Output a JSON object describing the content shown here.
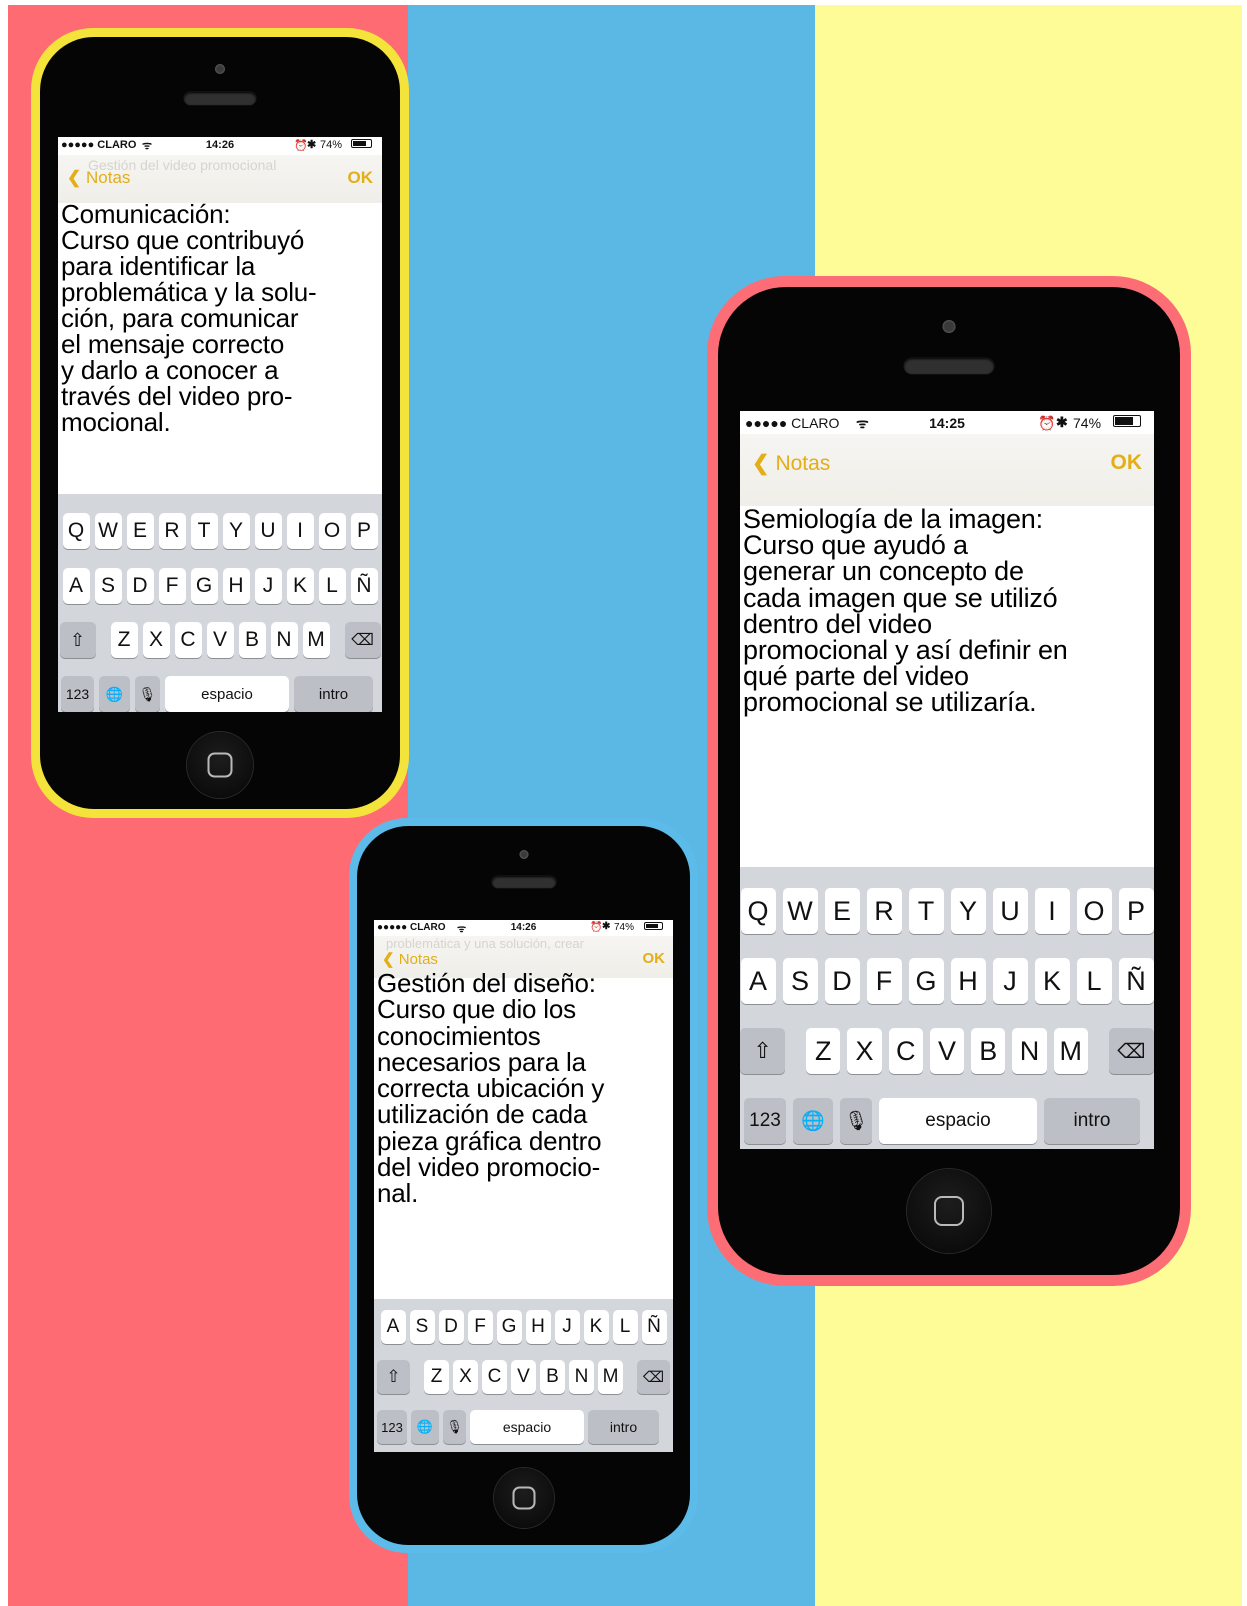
{
  "colors": {
    "stripe_red": "#fe6b72",
    "stripe_blue": "#5bb8e5",
    "stripe_yellow": "#fefc96",
    "phone_yellow": "#f3e33a",
    "phone_blue": "#5cbbe9",
    "phone_pink": "#fc6d75",
    "accent": "#e3ae18"
  },
  "icons": [
    "signal-dots-icon",
    "wifi-icon",
    "alarm-icon",
    "bluetooth-icon",
    "battery-icon",
    "chevron-left-icon",
    "shift-icon",
    "delete-icon",
    "globe-icon",
    "microphone-icon",
    "home-square-icon"
  ],
  "phones": [
    {
      "id": "yellow",
      "status": {
        "carrier": "●●●●● CLARO",
        "time": "14:26",
        "battery": "74%"
      },
      "nav": {
        "back": "Notas",
        "done": "OK"
      },
      "ghost_text": "Gestión del video promocional",
      "note": "Comunicación:\nCurso que contribuyó\npara identificar la\nproblemática y la solu-\nción, para comunicar\nel mensaje correcto\ny darlo a conocer a\ntravés del video pro-\nmocional."
    },
    {
      "id": "blue",
      "status": {
        "carrier": "●●●●● CLARO",
        "time": "14:26",
        "battery": "74%"
      },
      "nav": {
        "back": "Notas",
        "done": "OK"
      },
      "ghost_text": "problemática y una solución, crear",
      "note": "Gestión del diseño:\nCurso que dio los\nconocimientos\nnecesarios para la\ncorrecta ubicación y\nutilización de cada\npieza gráfica dentro\ndel video promocio-\nnal."
    },
    {
      "id": "pink",
      "status": {
        "carrier": "●●●●● CLARO",
        "time": "14:25",
        "battery": "74%"
      },
      "nav": {
        "back": "Notas",
        "done": "OK"
      },
      "note": "Semiología de la imagen:\nCurso que ayudó a\ngenerar un concepto de\ncada imagen que se utilizó\ndentro del   video\npromocional y así definir en\nqué parte del video\npromocional se utilizaría."
    }
  ],
  "keyboard": {
    "row1": [
      "Q",
      "W",
      "E",
      "R",
      "T",
      "Y",
      "U",
      "I",
      "O",
      "P"
    ],
    "row2": [
      "A",
      "S",
      "D",
      "F",
      "G",
      "H",
      "J",
      "K",
      "L",
      "Ñ"
    ],
    "row3": [
      "Z",
      "X",
      "C",
      "V",
      "B",
      "N",
      "M"
    ],
    "numbers": "123",
    "space": "espacio",
    "return": "intro",
    "shift_glyph": "⇧",
    "delete_glyph": "⌫",
    "globe_glyph": "🌐",
    "mic_glyph": "🎙"
  }
}
